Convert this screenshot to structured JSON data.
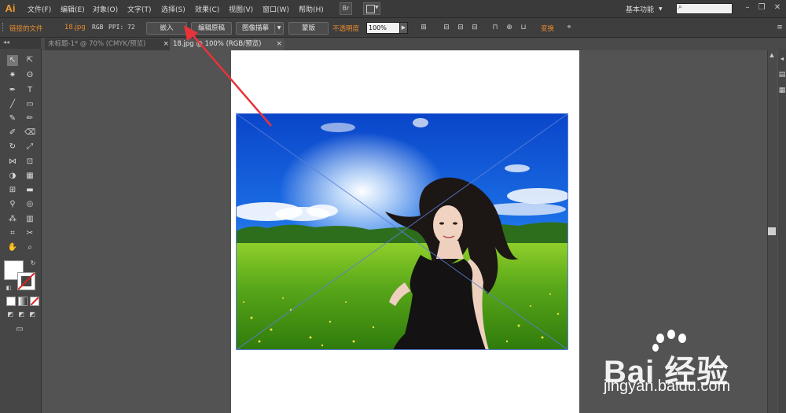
{
  "app": {
    "logo": "Ai"
  },
  "menu": {
    "items": [
      "文件(F)",
      "编辑(E)",
      "对象(O)",
      "文字(T)",
      "选择(S)",
      "效果(C)",
      "视图(V)",
      "窗口(W)",
      "帮助(H)"
    ],
    "bridge_label": "Br",
    "workspace": "基本功能"
  },
  "control_bar": {
    "linked_file": "链接的文件",
    "filename": "18.jpg",
    "color_mode": "RGB",
    "ppi": "PPI: 72",
    "embed": "嵌入",
    "edit_original": "编辑原稿",
    "image_trace": "图像描摹",
    "mask": "蒙版",
    "opacity_label": "不透明度",
    "opacity_value": "100%",
    "transform": "变换"
  },
  "tabs": [
    {
      "label": "未标题-1* @ 70% (CMYK/预览)",
      "close": "×"
    },
    {
      "label": "18.jpg @ 100% (RGB/预览)",
      "close": "×"
    }
  ],
  "watermark": {
    "brand": "Bai  经验",
    "url": "jingyan.baidu.com"
  },
  "colors": {
    "accent": "#e88b2e",
    "annotation_arrow": "#e8333a",
    "selection": "#5a7fd8"
  }
}
